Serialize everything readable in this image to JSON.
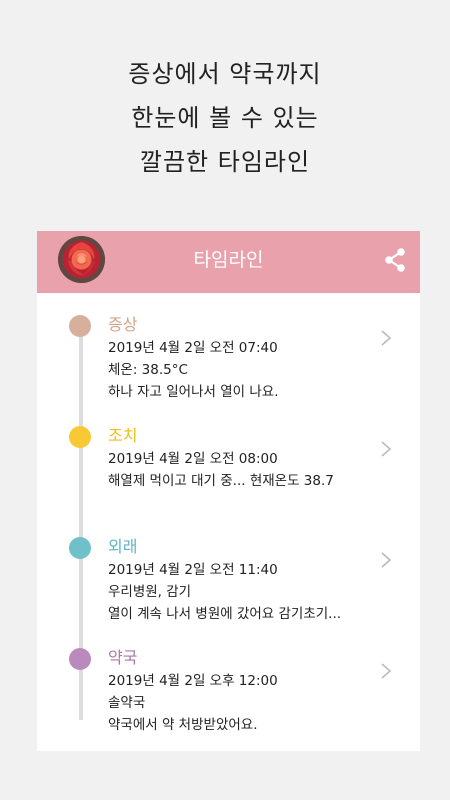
{
  "headline": {
    "line1": "증상에서 약국까지",
    "line2": "한눈에 볼 수 있는",
    "line3": "깔끔한 타임라인"
  },
  "appbar": {
    "title": "타임라인",
    "color": "#e9a2ac",
    "avatar_icon": "rose-flower-avatar",
    "share_icon": "share-icon"
  },
  "entries": [
    {
      "title": "증상",
      "color": "#d6b09c",
      "datetime": "2019년 4월 2일 오전 07:40",
      "detail1": "체온: 38.5°C",
      "detail2": "하나 자고 일어나서 열이 나요."
    },
    {
      "title": "조치",
      "color": "#f7c934",
      "datetime": "2019년 4월 2일 오전 08:00",
      "detail1": "해열제 먹이고 대기 중... 현재온도 38.7",
      "detail2": ""
    },
    {
      "title": "외래",
      "color": "#6fc0c8",
      "datetime": "2019년 4월 2일 오전 11:40",
      "detail1": "우리병원, 감기",
      "detail2": "열이 계속 나서 병원에 갔어요 감기초기..."
    },
    {
      "title": "약국",
      "color": "#b98abb",
      "datetime": "2019년 4월 2일 오후 12:00",
      "detail1": "솔약국",
      "detail2": "약국에서 약 처방받았어요."
    }
  ]
}
